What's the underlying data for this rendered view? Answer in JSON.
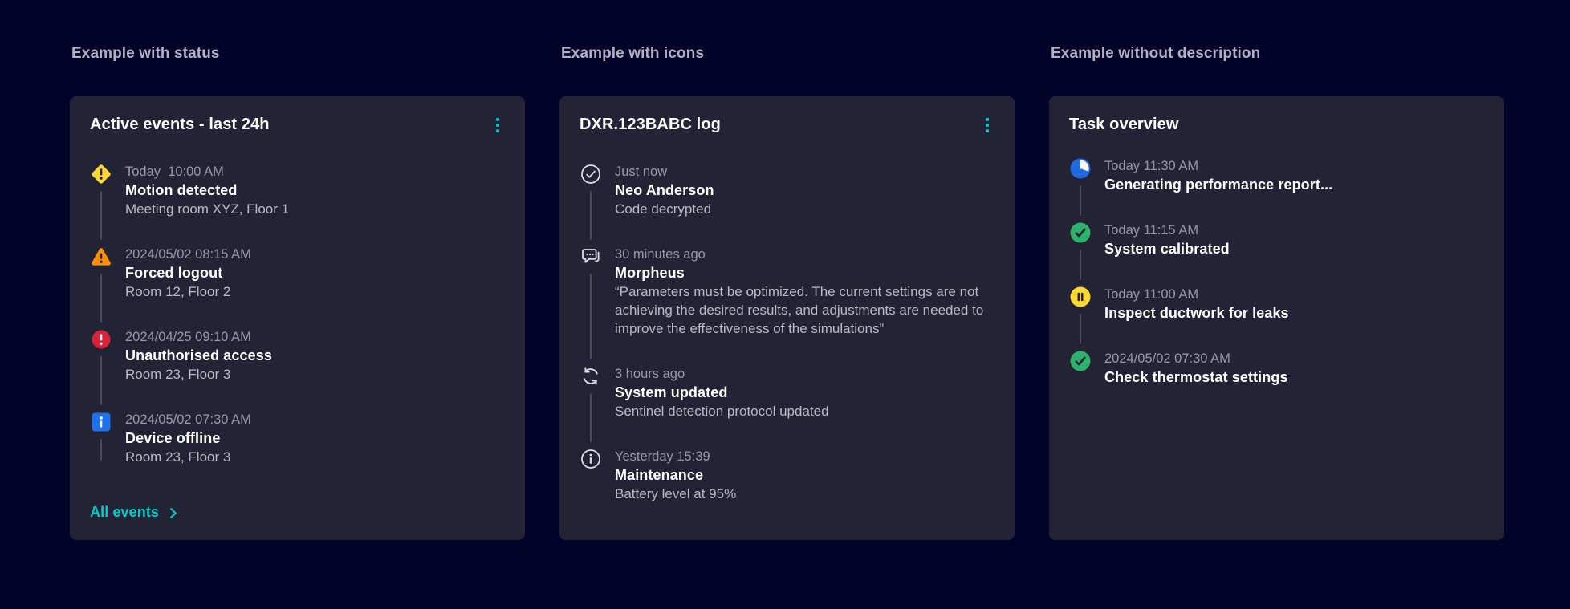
{
  "page": {
    "background": "#030329",
    "card_background": "#232336",
    "accent": "#00cccc",
    "status_colors": {
      "warning_yellow": "#ffd732",
      "alarm_orange": "#ff8f00",
      "error_red": "#d72339",
      "info_blue": "#1e70eb",
      "success_green": "#2eb26b",
      "progress_blue": "#2268e0"
    }
  },
  "sections": [
    {
      "heading": "Example with status",
      "card": {
        "title": "Active events - last 24h",
        "menu_icon": "kebab-menu-icon",
        "events": [
          {
            "icon": "warning-diamond",
            "timestamp": "Today  10:00 AM",
            "title": "Motion detected",
            "description": "Meeting room XYZ, Floor 1"
          },
          {
            "icon": "alarm-triangle",
            "timestamp": "2024/05/02 08:15 AM",
            "title": "Forced logout",
            "description": "Room 12, Floor 2"
          },
          {
            "icon": "error-circle",
            "timestamp": "2024/04/25 09:10 AM",
            "title": "Unauthorised access",
            "description": "Room 23, Floor 3"
          },
          {
            "icon": "info-square",
            "timestamp": "2024/05/02 07:30 AM",
            "title": "Device offline",
            "description": "Room 23, Floor 3"
          }
        ],
        "footer_link": {
          "label": "All events",
          "chevron_icon": "chevron-right-icon"
        }
      }
    },
    {
      "heading": "Example with icons",
      "card": {
        "title": "DXR.123BABC log",
        "menu_icon": "kebab-menu-icon",
        "events": [
          {
            "icon": "check-circle-outline",
            "timestamp": "Just now",
            "title": "Neo Anderson",
            "description": "Code decrypted"
          },
          {
            "icon": "chat-bubble-outline",
            "timestamp": "30 minutes ago",
            "title": "Morpheus",
            "description": "“Parameters must be optimized. The current settings are not achieving the desired results, and adjustments are needed to improve the effectiveness of the simulations”"
          },
          {
            "icon": "refresh-outline",
            "timestamp": "3 hours ago",
            "title": "System updated",
            "description": "Sentinel detection protocol updated"
          },
          {
            "icon": "info-circle-outline",
            "timestamp": "Yesterday 15:39",
            "title": "Maintenance",
            "description": "Battery level at 95%"
          }
        ]
      }
    },
    {
      "heading": "Example without description",
      "card": {
        "title": "Task overview",
        "events": [
          {
            "icon": "progress-pie",
            "timestamp": "Today 11:30 AM",
            "title": "Generating performance report..."
          },
          {
            "icon": "success-check",
            "timestamp": "Today 11:15 AM",
            "title": "System calibrated"
          },
          {
            "icon": "paused-circle",
            "timestamp": "Today 11:00 AM",
            "title": "Inspect ductwork for leaks"
          },
          {
            "icon": "success-check",
            "timestamp": "2024/05/02 07:30 AM",
            "title": "Check thermostat settings"
          }
        ]
      }
    }
  ]
}
